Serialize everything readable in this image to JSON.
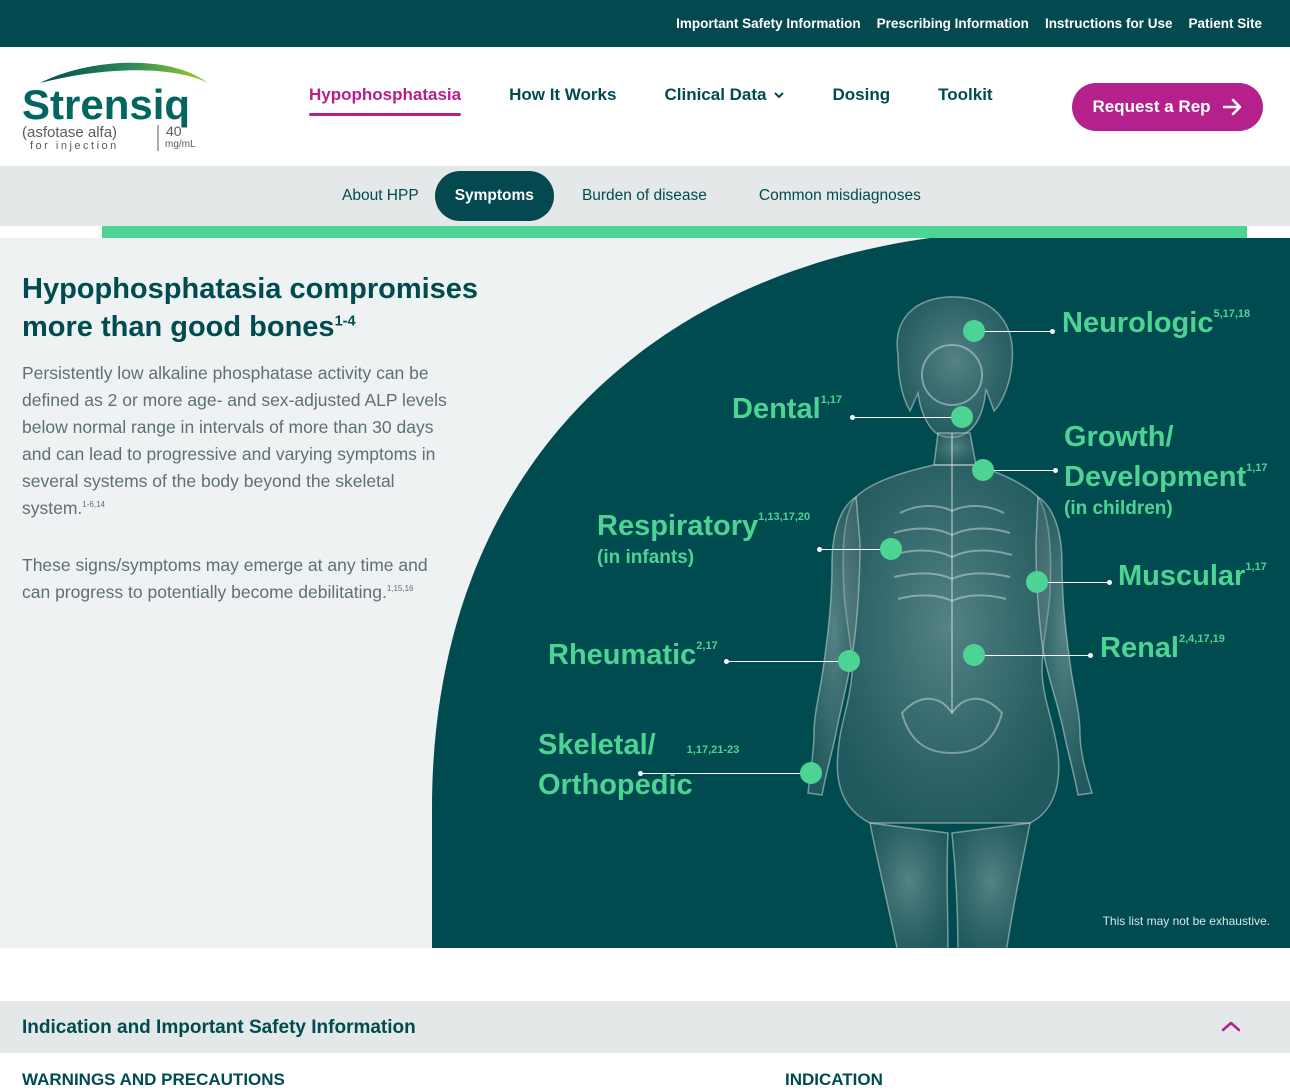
{
  "utility": {
    "links": [
      "Important Safety Information",
      "Prescribing Information",
      "Instructions for Use",
      "Patient Site"
    ]
  },
  "logo": {
    "brand": "Strensiq",
    "generic": "(asfotase alfa)",
    "for_injection": "for injection",
    "strength": "40",
    "unit": "mg/mL"
  },
  "nav": {
    "items": [
      "Hypophosphatasia",
      "How It Works",
      "Clinical Data",
      "Dosing",
      "Toolkit"
    ],
    "active_index": 0,
    "request_button": "Request a Rep"
  },
  "subnav": {
    "tabs": [
      "About HPP",
      "Symptoms",
      "Burden of disease",
      "Common misdiagnoses"
    ],
    "active_index": 1,
    "progress_fraction": 0.92
  },
  "hero": {
    "title": "Hypophosphatasia compromises more than good bones",
    "title_ref": "1-4",
    "p1": "Persistently low alkaline phosphatase activity can be defined as 2 or more age- and sex-adjusted ALP levels below normal range in intervals of more than 30 days and can lead to progressive and varying symptoms in several systems of the body beyond the skeletal system.",
    "p1_ref": "1-6,14",
    "p2": "These signs/symptoms may emerge at any time and can progress to potentially become debilitating.",
    "p2_ref": "1,15,16",
    "disclaimer": "This list may not be exhaustive."
  },
  "symptoms": {
    "neurologic": {
      "label": "Neurologic",
      "refs": "5,17,18"
    },
    "dental": {
      "label": "Dental",
      "refs": "1,17"
    },
    "growth": {
      "label": "Growth/",
      "label2": "Development",
      "refs": "1,17",
      "sub": "(in children)"
    },
    "respiratory": {
      "label": "Respiratory",
      "refs": "1,13,17,20",
      "sub": "(in infants)"
    },
    "muscular": {
      "label": "Muscular",
      "refs": "1,17"
    },
    "renal": {
      "label": "Renal",
      "refs": "2,4,17,19"
    },
    "rheumatic": {
      "label": "Rheumatic",
      "refs": "2,17"
    },
    "skeletal": {
      "label": "Skeletal/",
      "label2": "Orthopedic",
      "refs": "1,17,21-23"
    }
  },
  "isi": {
    "title": "Indication and Important Safety Information",
    "col_left": "WARNINGS AND PRECAUTIONS",
    "col_right": "INDICATION"
  },
  "colors": {
    "teal_dark": "#054950",
    "magenta": "#b5208d",
    "green": "#4dd494",
    "lime": "#8cc63f"
  }
}
